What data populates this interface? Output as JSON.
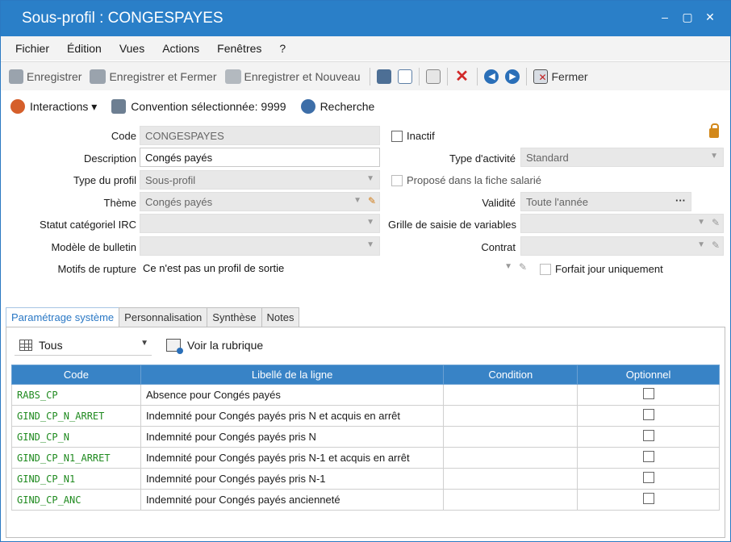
{
  "window": {
    "title": "Sous-profil : CONGESPAYES",
    "minimize": "–",
    "maximize": "▢",
    "close": "✕"
  },
  "menu": [
    "Fichier",
    "Édition",
    "Vues",
    "Actions",
    "Fenêtres",
    "?"
  ],
  "toolbar": {
    "save": "Enregistrer",
    "save_close": "Enregistrer et Fermer",
    "save_new": "Enregistrer et Nouveau",
    "close": "Fermer"
  },
  "subtoolbar": {
    "interactions": "Interactions ▾",
    "convention": "Convention sélectionnée: 9999",
    "search": "Recherche"
  },
  "form": {
    "code_label": "Code",
    "code_value": "CONGESPAYES",
    "inactif_label": "Inactif",
    "description_label": "Description",
    "description_value": "Congés payés",
    "type_activite_label": "Type d'activité",
    "type_activite_value": "Standard",
    "type_profil_label": "Type du profil",
    "type_profil_value": "Sous-profil",
    "propose_label": "Proposé dans la fiche salarié",
    "theme_label": "Thème",
    "theme_value": "Congés payés",
    "validite_label": "Validité",
    "validite_value": "Toute l'année",
    "statut_label": "Statut catégoriel IRC",
    "statut_value": "",
    "grille_label": "Grille de saisie de variables",
    "grille_value": "",
    "modele_label": "Modèle de bulletin",
    "modele_value": "",
    "contrat_label": "Contrat",
    "contrat_value": "",
    "motifs_label": "Motifs de rupture",
    "motifs_value": "Ce n'est pas un profil de sortie",
    "forfait_label": "Forfait jour uniquement"
  },
  "tabs": [
    "Paramétrage système",
    "Personnalisation",
    "Synthèse",
    "Notes"
  ],
  "filter": {
    "selected": "Tous",
    "voir_label": "Voir la rubrique"
  },
  "grid": {
    "columns": [
      "Code",
      "Libellé de la ligne",
      "Condition",
      "Optionnel"
    ],
    "rows": [
      {
        "code": "RABS_CP",
        "label": "Absence pour Congés payés",
        "condition": ""
      },
      {
        "code": "GIND_CP_N_ARRET",
        "label": "Indemnité pour Congés payés pris N et acquis en arrêt",
        "condition": ""
      },
      {
        "code": "GIND_CP_N",
        "label": "Indemnité pour Congés payés pris N",
        "condition": ""
      },
      {
        "code": "GIND_CP_N1_ARRET",
        "label": "Indemnité pour Congés payés pris N-1 et acquis en arrêt",
        "condition": ""
      },
      {
        "code": "GIND_CP_N1",
        "label": "Indemnité pour Congés payés pris N-1",
        "condition": ""
      },
      {
        "code": "GIND_CP_ANC",
        "label": "Indemnité pour Congés payés ancienneté",
        "condition": ""
      }
    ]
  }
}
